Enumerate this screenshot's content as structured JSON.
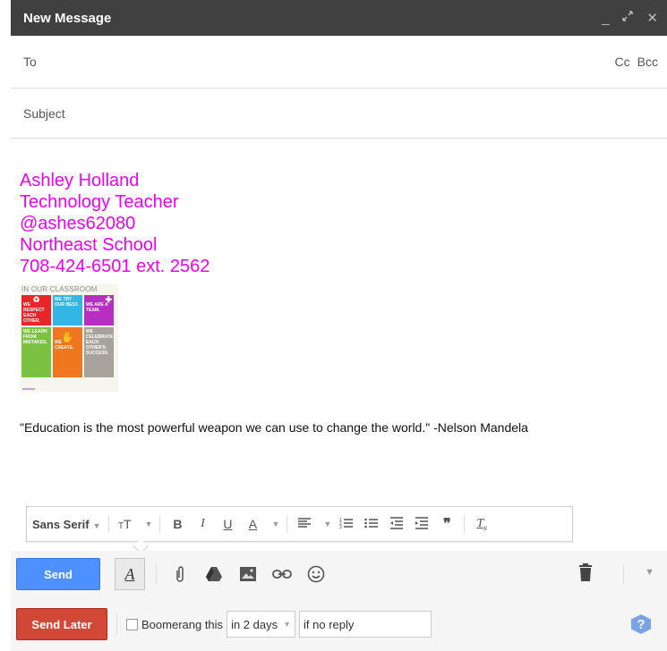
{
  "window": {
    "title": "New Message"
  },
  "header": {
    "to_label": "To",
    "cc_label": "Cc",
    "bcc_label": "Bcc",
    "subject_placeholder": "Subject"
  },
  "signature": {
    "lines": [
      "Ashley Holland",
      "Technology Teacher",
      "@ashes62080",
      "Northeast School",
      "708-424-6501 ext. 2562"
    ],
    "color": "#f300f3"
  },
  "poster": {
    "title": "IN OUR CLASSROOM",
    "tiles": [
      {
        "text": "WE RESPECT EACH OTHER.",
        "color": "#e8262a"
      },
      {
        "text": "WE TRY OUR BEST.",
        "color": "#33b6e5"
      },
      {
        "text": "WE ARE A TEAM.",
        "color": "#b72fc0"
      },
      {
        "text": "WE LEARN FROM MISTAKES.",
        "color": "#7cc242"
      },
      {
        "text": "WE CREATE.",
        "color": "#f0761f"
      },
      {
        "text": "WE CELEBRATE EACH OTHER'S SUCCESS.",
        "color": "#a8a39a"
      }
    ]
  },
  "quote": "\"Education is the most powerful weapon we can use to change the world.\" -Nelson Mandela",
  "formatting": {
    "font": "Sans Serif"
  },
  "toolbar": {
    "send_label": "Send"
  },
  "bottom": {
    "send_later_label": "Send Later",
    "boomerang_label": "Boomerang this",
    "delay_value": "in 2 days",
    "condition_value": "if no reply"
  },
  "colors": {
    "send": "#4d90fe",
    "send_later": "#d14836",
    "titlebar": "#404040"
  }
}
